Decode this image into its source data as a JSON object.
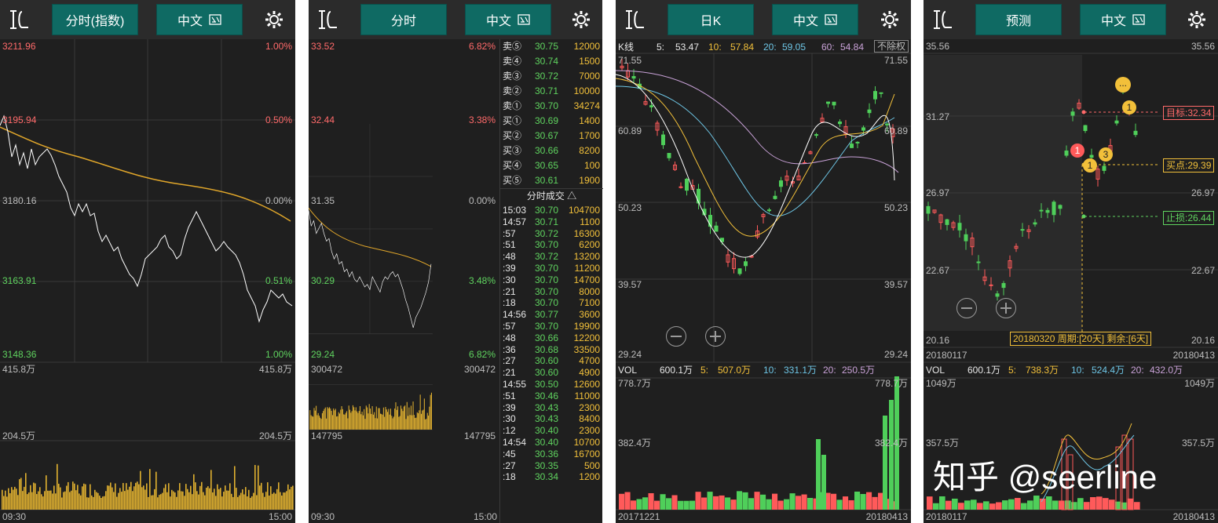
{
  "panels": [
    {
      "tab": "分时(指数)",
      "lang": "中文"
    },
    {
      "tab": "分时",
      "lang": "中文"
    },
    {
      "tab": "日K",
      "lang": "中文"
    },
    {
      "tab": "预测",
      "lang": "中文"
    }
  ],
  "p1": {
    "left_labels": [
      "3211.96",
      "3195.94",
      "3180.16",
      "3163.91",
      "3148.36"
    ],
    "right_labels": [
      "1.00%",
      "0.50%",
      "0.00%",
      "0.51%",
      "1.00%"
    ],
    "vol_top": "415.8万",
    "vol_mid": "204.5万",
    "vol_top_r": "415.8万",
    "vol_mid_r": "204.5万",
    "time_start": "09:30",
    "time_end": "15:00"
  },
  "p2": {
    "left_labels": [
      "33.52",
      "32.44",
      "31.35",
      "30.29",
      "29.24"
    ],
    "right_labels": [
      "6.82%",
      "3.38%",
      "0.00%",
      "3.48%",
      "6.82%"
    ],
    "vol_top": "300472",
    "vol_mid": "147795",
    "vol_top_r": "300472",
    "vol_mid_r": "147795",
    "time_start": "09:30",
    "time_end": "15:00",
    "order_book": [
      {
        "side": "卖⑤",
        "price": "30.75",
        "vol": "12000"
      },
      {
        "side": "卖④",
        "price": "30.74",
        "vol": "1500"
      },
      {
        "side": "卖③",
        "price": "30.72",
        "vol": "7000"
      },
      {
        "side": "卖②",
        "price": "30.71",
        "vol": "10000"
      },
      {
        "side": "卖①",
        "price": "30.70",
        "vol": "34274"
      },
      {
        "side": "买①",
        "price": "30.69",
        "vol": "1400"
      },
      {
        "side": "买②",
        "price": "30.67",
        "vol": "1700"
      },
      {
        "side": "买③",
        "price": "30.66",
        "vol": "8200"
      },
      {
        "side": "买④",
        "price": "30.65",
        "vol": "100"
      },
      {
        "side": "买⑤",
        "price": "30.61",
        "vol": "1900"
      }
    ],
    "trades_header": "分时成交 △",
    "trades": [
      {
        "t": "15:03",
        "price": "30.70",
        "vol": "104700"
      },
      {
        "t": "14:57",
        "price": "30.71",
        "vol": "1100"
      },
      {
        "t": ":57",
        "price": "30.72",
        "vol": "16300"
      },
      {
        "t": ":51",
        "price": "30.70",
        "vol": "6200"
      },
      {
        "t": ":48",
        "price": "30.72",
        "vol": "13200"
      },
      {
        "t": ":39",
        "price": "30.70",
        "vol": "11200"
      },
      {
        "t": ":30",
        "price": "30.70",
        "vol": "14700"
      },
      {
        "t": ":21",
        "price": "30.70",
        "vol": "8000"
      },
      {
        "t": ":18",
        "price": "30.70",
        "vol": "7100"
      },
      {
        "t": "14:56",
        "price": "30.77",
        "vol": "3600"
      },
      {
        "t": ":57",
        "price": "30.70",
        "vol": "19900"
      },
      {
        "t": ":48",
        "price": "30.66",
        "vol": "12200"
      },
      {
        "t": ":36",
        "price": "30.68",
        "vol": "33500"
      },
      {
        "t": ":27",
        "price": "30.60",
        "vol": "4700"
      },
      {
        "t": ":21",
        "price": "30.60",
        "vol": "4900"
      },
      {
        "t": "14:55",
        "price": "30.50",
        "vol": "12600"
      },
      {
        "t": ":51",
        "price": "30.46",
        "vol": "11000"
      },
      {
        "t": ":39",
        "price": "30.43",
        "vol": "2300"
      },
      {
        "t": ":30",
        "price": "30.43",
        "vol": "8400"
      },
      {
        "t": ":12",
        "price": "30.40",
        "vol": "2300"
      },
      {
        "t": "14:54",
        "price": "30.40",
        "vol": "10700"
      },
      {
        "t": ":45",
        "price": "30.36",
        "vol": "16700"
      },
      {
        "t": ":27",
        "price": "30.35",
        "vol": "500"
      },
      {
        "t": ":18",
        "price": "30.34",
        "vol": "1200"
      }
    ]
  },
  "p3": {
    "kline_label": "K线",
    "ma": [
      {
        "k": "5:",
        "v": "53.47"
      },
      {
        "k": "10:",
        "v": "57.84"
      },
      {
        "k": "20:",
        "v": "59.05"
      },
      {
        "k": "60:",
        "v": "54.84"
      }
    ],
    "adj_badge": "不除权",
    "prices": [
      "71.55",
      "60.89",
      "50.23",
      "39.57",
      "29.24"
    ],
    "prices_r": [
      "71.55",
      "60.89",
      "50.23",
      "39.57",
      "29.24"
    ],
    "vol_label": "VOL",
    "vol_values": [
      {
        "k": "",
        "v": "600.1万"
      },
      {
        "k": "5:",
        "v": "507.0万"
      },
      {
        "k": "10:",
        "v": "331.1万"
      },
      {
        "k": "20:",
        "v": "250.5万"
      }
    ],
    "vol_top": "778.7万",
    "vol_mid": "382.4万",
    "vol_top_r": "778.7万",
    "vol_mid_r": "382.4万",
    "date_start": "20171221",
    "date_end": "20180413"
  },
  "p4": {
    "prices": [
      "35.56",
      "31.27",
      "26.97",
      "22.67",
      "20.16"
    ],
    "prices_r": [
      "35.56",
      "26.97",
      "22.67",
      "20.16"
    ],
    "target": "目标:32.34",
    "buy": "买点:29.39",
    "stop": "止损:26.44",
    "period_info": "20180320 周期:[20天] 剩余:[6天]",
    "badges": [
      "1",
      "1",
      "3",
      "1",
      "..."
    ],
    "vol_label": "VOL",
    "vol_values": [
      {
        "k": "",
        "v": "600.1万"
      },
      {
        "k": "5:",
        "v": "738.3万"
      },
      {
        "k": "10:",
        "v": "524.4万"
      },
      {
        "k": "20:",
        "v": "432.0万"
      }
    ],
    "vol_top": "1049万",
    "vol_mid": "357.5万",
    "vol_top_r": "1049万",
    "vol_mid_r": "357.5万",
    "date_start": "20180117",
    "date_end": "20180413",
    "date_mid_start": "20180117",
    "date_mid_end": "20180413"
  },
  "watermark": "知乎 @seerline",
  "colors": {
    "up": "#ff5a5a",
    "down": "#4fcf5a",
    "teal_button": "#0f6a63",
    "avg_line": "#e0a62a",
    "bg": "#1f1f1f"
  }
}
